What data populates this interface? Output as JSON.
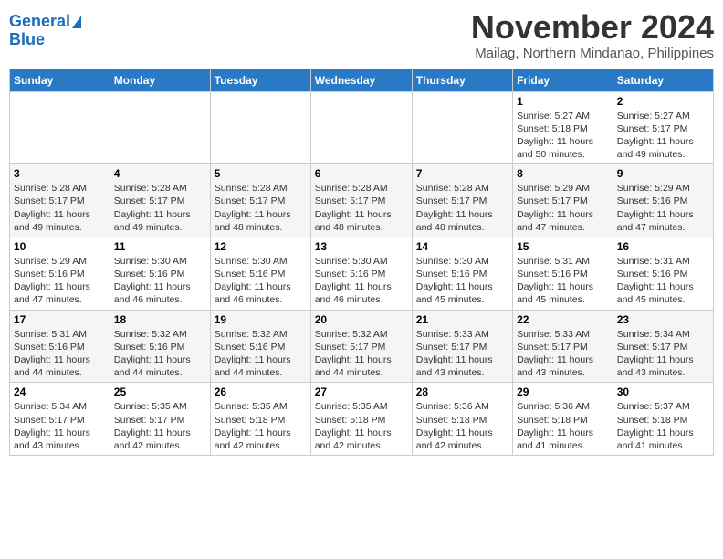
{
  "logo": {
    "line1": "General",
    "line2": "Blue"
  },
  "title": "November 2024",
  "subtitle": "Mailag, Northern Mindanao, Philippines",
  "days_header": [
    "Sunday",
    "Monday",
    "Tuesday",
    "Wednesday",
    "Thursday",
    "Friday",
    "Saturday"
  ],
  "weeks": [
    [
      {
        "day": "",
        "info": ""
      },
      {
        "day": "",
        "info": ""
      },
      {
        "day": "",
        "info": ""
      },
      {
        "day": "",
        "info": ""
      },
      {
        "day": "",
        "info": ""
      },
      {
        "day": "1",
        "info": "Sunrise: 5:27 AM\nSunset: 5:18 PM\nDaylight: 11 hours and 50 minutes."
      },
      {
        "day": "2",
        "info": "Sunrise: 5:27 AM\nSunset: 5:17 PM\nDaylight: 11 hours and 49 minutes."
      }
    ],
    [
      {
        "day": "3",
        "info": "Sunrise: 5:28 AM\nSunset: 5:17 PM\nDaylight: 11 hours and 49 minutes."
      },
      {
        "day": "4",
        "info": "Sunrise: 5:28 AM\nSunset: 5:17 PM\nDaylight: 11 hours and 49 minutes."
      },
      {
        "day": "5",
        "info": "Sunrise: 5:28 AM\nSunset: 5:17 PM\nDaylight: 11 hours and 48 minutes."
      },
      {
        "day": "6",
        "info": "Sunrise: 5:28 AM\nSunset: 5:17 PM\nDaylight: 11 hours and 48 minutes."
      },
      {
        "day": "7",
        "info": "Sunrise: 5:28 AM\nSunset: 5:17 PM\nDaylight: 11 hours and 48 minutes."
      },
      {
        "day": "8",
        "info": "Sunrise: 5:29 AM\nSunset: 5:17 PM\nDaylight: 11 hours and 47 minutes."
      },
      {
        "day": "9",
        "info": "Sunrise: 5:29 AM\nSunset: 5:16 PM\nDaylight: 11 hours and 47 minutes."
      }
    ],
    [
      {
        "day": "10",
        "info": "Sunrise: 5:29 AM\nSunset: 5:16 PM\nDaylight: 11 hours and 47 minutes."
      },
      {
        "day": "11",
        "info": "Sunrise: 5:30 AM\nSunset: 5:16 PM\nDaylight: 11 hours and 46 minutes."
      },
      {
        "day": "12",
        "info": "Sunrise: 5:30 AM\nSunset: 5:16 PM\nDaylight: 11 hours and 46 minutes."
      },
      {
        "day": "13",
        "info": "Sunrise: 5:30 AM\nSunset: 5:16 PM\nDaylight: 11 hours and 46 minutes."
      },
      {
        "day": "14",
        "info": "Sunrise: 5:30 AM\nSunset: 5:16 PM\nDaylight: 11 hours and 45 minutes."
      },
      {
        "day": "15",
        "info": "Sunrise: 5:31 AM\nSunset: 5:16 PM\nDaylight: 11 hours and 45 minutes."
      },
      {
        "day": "16",
        "info": "Sunrise: 5:31 AM\nSunset: 5:16 PM\nDaylight: 11 hours and 45 minutes."
      }
    ],
    [
      {
        "day": "17",
        "info": "Sunrise: 5:31 AM\nSunset: 5:16 PM\nDaylight: 11 hours and 44 minutes."
      },
      {
        "day": "18",
        "info": "Sunrise: 5:32 AM\nSunset: 5:16 PM\nDaylight: 11 hours and 44 minutes."
      },
      {
        "day": "19",
        "info": "Sunrise: 5:32 AM\nSunset: 5:16 PM\nDaylight: 11 hours and 44 minutes."
      },
      {
        "day": "20",
        "info": "Sunrise: 5:32 AM\nSunset: 5:17 PM\nDaylight: 11 hours and 44 minutes."
      },
      {
        "day": "21",
        "info": "Sunrise: 5:33 AM\nSunset: 5:17 PM\nDaylight: 11 hours and 43 minutes."
      },
      {
        "day": "22",
        "info": "Sunrise: 5:33 AM\nSunset: 5:17 PM\nDaylight: 11 hours and 43 minutes."
      },
      {
        "day": "23",
        "info": "Sunrise: 5:34 AM\nSunset: 5:17 PM\nDaylight: 11 hours and 43 minutes."
      }
    ],
    [
      {
        "day": "24",
        "info": "Sunrise: 5:34 AM\nSunset: 5:17 PM\nDaylight: 11 hours and 43 minutes."
      },
      {
        "day": "25",
        "info": "Sunrise: 5:35 AM\nSunset: 5:17 PM\nDaylight: 11 hours and 42 minutes."
      },
      {
        "day": "26",
        "info": "Sunrise: 5:35 AM\nSunset: 5:18 PM\nDaylight: 11 hours and 42 minutes."
      },
      {
        "day": "27",
        "info": "Sunrise: 5:35 AM\nSunset: 5:18 PM\nDaylight: 11 hours and 42 minutes."
      },
      {
        "day": "28",
        "info": "Sunrise: 5:36 AM\nSunset: 5:18 PM\nDaylight: 11 hours and 42 minutes."
      },
      {
        "day": "29",
        "info": "Sunrise: 5:36 AM\nSunset: 5:18 PM\nDaylight: 11 hours and 41 minutes."
      },
      {
        "day": "30",
        "info": "Sunrise: 5:37 AM\nSunset: 5:18 PM\nDaylight: 11 hours and 41 minutes."
      }
    ]
  ]
}
